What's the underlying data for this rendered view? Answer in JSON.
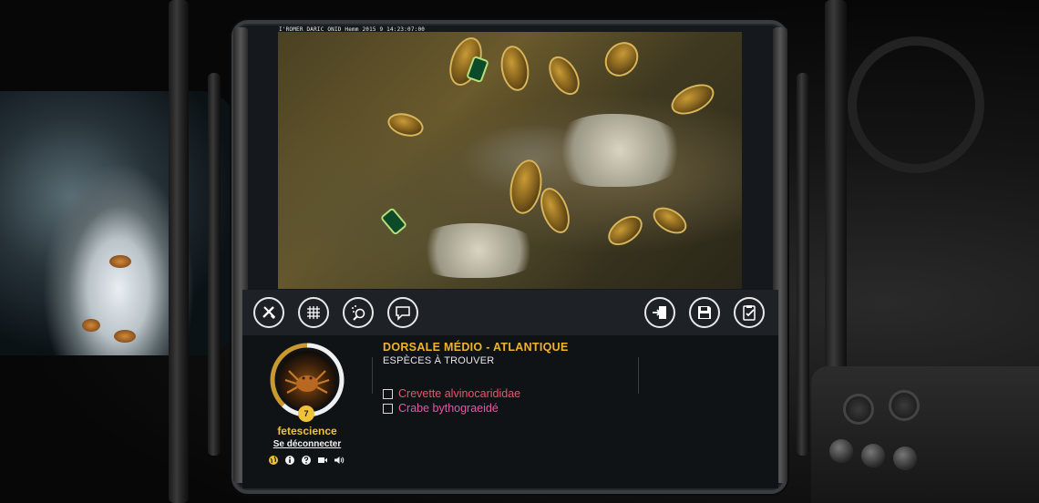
{
  "camera": {
    "timestamp": "I'ROMER DARIC  ONID Hemm 2015  9 14:23:07:00"
  },
  "toolbar": {
    "left_tools": [
      {
        "name": "measure-tool",
        "icon": "ruler-pencil-icon"
      },
      {
        "name": "grid-tool",
        "icon": "grid-icon"
      },
      {
        "name": "zoom-tool",
        "icon": "magnifier-icon"
      },
      {
        "name": "comment-tool",
        "icon": "speech-bubble-icon"
      }
    ],
    "right_tools": [
      {
        "name": "exit-tool",
        "icon": "exit-door-icon"
      },
      {
        "name": "save-tool",
        "icon": "floppy-disk-icon"
      },
      {
        "name": "checklist-tool",
        "icon": "clipboard-check-icon"
      }
    ]
  },
  "user": {
    "username": "fetescience",
    "logout_label": "Se déconnecter",
    "level": "7",
    "progress": 0.62
  },
  "footer_icons": [
    "globe-icon",
    "info-icon",
    "help-icon",
    "video-icon",
    "sound-icon"
  ],
  "mission": {
    "region": "DORSALE MÉDIO - ATLANTIQUE",
    "heading": "ESPÈCES À TROUVER",
    "species": [
      {
        "label": "Crevette alvinocarididae",
        "checked": false,
        "color": "#f0506e"
      },
      {
        "label": "Crabe bythograeidé",
        "checked": false,
        "color": "#f052a8"
      }
    ]
  },
  "colors": {
    "accent": "#f0b42a",
    "panel": "#15191d",
    "toolbar": "#1e2226"
  }
}
